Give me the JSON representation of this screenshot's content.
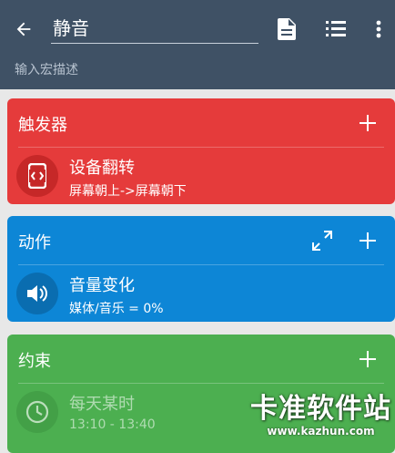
{
  "appbar": {
    "title": "静音",
    "description_placeholder": "输入宏描述",
    "back_icon": "arrow-left-icon",
    "tools": [
      "document-icon",
      "list-icon",
      "more-vert-icon"
    ],
    "color": "#3f5165"
  },
  "triggers": {
    "header": "触发器",
    "color": "#e53b3b",
    "items": [
      {
        "title": "设备翻转",
        "subtitle": "屏幕朝上->屏幕朝下",
        "icon": "device-flip-icon"
      }
    ]
  },
  "actions": {
    "header": "动作",
    "color": "#0d86d6",
    "items": [
      {
        "title": "音量变化",
        "subtitle": "媒体/音乐 = 0%",
        "icon": "volume-icon"
      }
    ]
  },
  "constraints": {
    "header": "约束",
    "color": "#4caf50",
    "items": [
      {
        "title": "每天某时",
        "subtitle": "13:10 - 13:40",
        "icon": "clock-icon"
      }
    ]
  },
  "watermark": {
    "main": "卡准软件站",
    "url": "www.kazhun.com"
  }
}
